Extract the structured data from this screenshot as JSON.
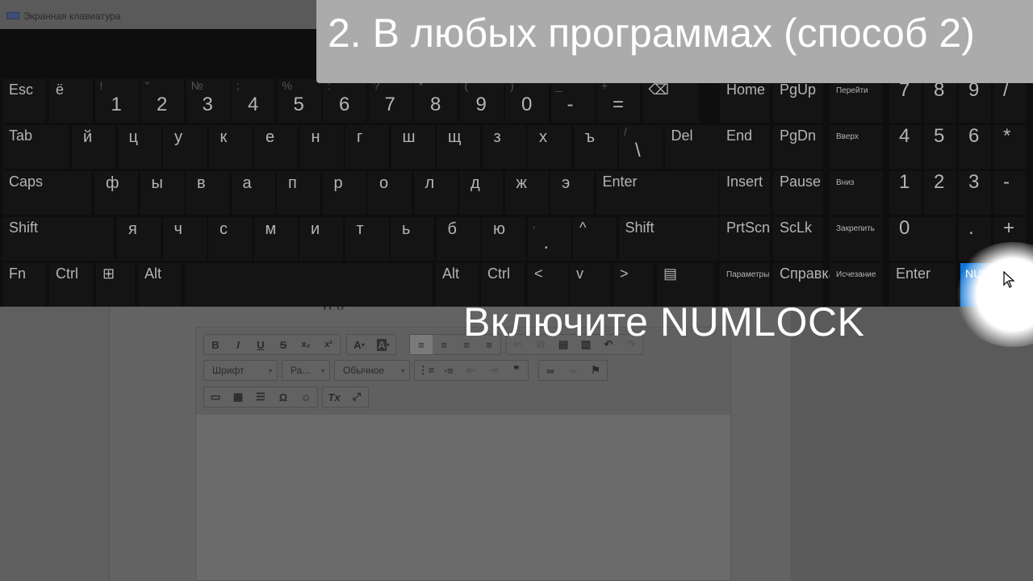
{
  "window": {
    "title": "Экранная клавиатура"
  },
  "banner": {
    "text": "2. В любых программах (способ 2)"
  },
  "caption": {
    "text": "Включите NUMLOCK"
  },
  "colors": {
    "accent": "#0a74d8",
    "banner_bg": "#ababab",
    "key_bg": "#141414",
    "key_text": "#b4b4b4"
  },
  "keyboard": {
    "row1": [
      {
        "main": "Esc",
        "sub": ""
      },
      {
        "main": "ё",
        "sub": ""
      },
      {
        "main": "1",
        "sub": "!"
      },
      {
        "main": "2",
        "sub": "\""
      },
      {
        "main": "3",
        "sub": "№"
      },
      {
        "main": "4",
        "sub": ";"
      },
      {
        "main": "5",
        "sub": "%"
      },
      {
        "main": "6",
        "sub": ":"
      },
      {
        "main": "7",
        "sub": "?"
      },
      {
        "main": "8",
        "sub": "*"
      },
      {
        "main": "9",
        "sub": "("
      },
      {
        "main": "0",
        "sub": ")"
      },
      {
        "main": "-",
        "sub": "_"
      },
      {
        "main": "=",
        "sub": "+"
      },
      {
        "main": "⌫",
        "sub": ""
      }
    ],
    "row2": [
      "Tab",
      "й",
      "ц",
      "у",
      "к",
      "е",
      "н",
      "г",
      "ш",
      "щ",
      "з",
      "х",
      "ъ",
      "\\",
      "Del"
    ],
    "row2_backslash_sub": "/",
    "row3": [
      "Caps",
      "ф",
      "ы",
      "в",
      "а",
      "п",
      "р",
      "о",
      "л",
      "д",
      "ж",
      "э",
      "Enter"
    ],
    "row4": [
      "Shift",
      "я",
      "ч",
      "с",
      "м",
      "и",
      "т",
      "ь",
      "б",
      "ю",
      ".",
      "^",
      "Shift"
    ],
    "row4_period_sub": ",",
    "row5": [
      "Fn",
      "Ctrl",
      "⊞",
      "Alt",
      "",
      "Alt",
      "Ctrl",
      "<",
      "v",
      ">",
      "▤"
    ],
    "nav": {
      "col1": [
        "Home",
        "End",
        "Insert",
        "PrtScn",
        "Параметры"
      ],
      "col2": [
        "PgUp",
        "PgDn",
        "Pause",
        "ScLk",
        "Справка"
      ],
      "col3": [
        "Перейти",
        "Вверх",
        "Вниз",
        "Закрепить",
        "Исчезание"
      ]
    },
    "numpad": {
      "row1": [
        "7",
        "8",
        "9",
        "/"
      ],
      "row2": [
        "4",
        "5",
        "6",
        "*"
      ],
      "row3": [
        "1",
        "2",
        "3",
        "-"
      ],
      "row4": [
        "0",
        ".",
        "+"
      ],
      "row5": [
        "Enter",
        "NUMLOCK"
      ]
    }
  },
  "editor": {
    "font_combo": "Шрифт",
    "size_combo": "Ра...",
    "style_combo": "Обычное",
    "toolbar1": [
      "B",
      "I",
      "U",
      "S",
      "x₂",
      "x²"
    ],
    "color_buttons": [
      "A",
      "A"
    ],
    "partial_heading": "  р      у  "
  }
}
